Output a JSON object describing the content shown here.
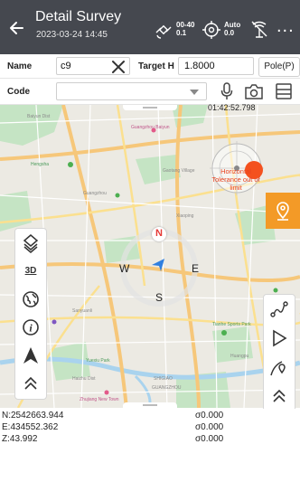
{
  "header": {
    "title": "Detail Survey",
    "subtitle": "2023-03-24 14:45",
    "sat_status": {
      "line1": "00-40",
      "line2": "0.1"
    },
    "fix_status": {
      "line1": "Auto",
      "line2": "0.0"
    },
    "more_label": "..."
  },
  "form": {
    "name_label": "Name",
    "name_value": "c9",
    "target_h_label": "Target H",
    "target_h_value": "1.8000",
    "pole_button": "Pole(P)",
    "code_label": "Code",
    "code_value": ""
  },
  "map": {
    "time": "01:42:52.798",
    "warning": "Horizontal Tolerance out of limit",
    "compass": {
      "n": "N",
      "s": "S",
      "w": "W",
      "e": "E"
    },
    "labels": [
      "Baiyun Dist",
      "Guangzhou Baiyun",
      "Hengsha",
      "Guangzhou",
      "Gaotang Village",
      "Xiaoping",
      "Sanyuanli",
      "Yuexiu Park",
      "Huangpu",
      "Haizhu Dist",
      "Zhujiang New Town",
      "Tianhe Sports Park",
      "SHIGIAO",
      "GUANGZHOU"
    ]
  },
  "toolbar_left": {
    "layers": "layers",
    "view3d": "3D",
    "globe": "globe",
    "info": "i",
    "north": "north",
    "collapse": "collapse"
  },
  "toolbar_right": {
    "route": "route",
    "stakeout": "stakeout",
    "line": "line",
    "collapse": "collapse"
  },
  "coords": {
    "n": "N:2542663.944",
    "e": "E:434552.362",
    "z": "Z:43.992",
    "sn": "σ0.000",
    "se": "σ0.000",
    "sz": "σ0.000"
  },
  "colors": {
    "header": "#45484f",
    "accent": "#f39a27",
    "warning": "#e8421e",
    "compass_n": "#e53935"
  }
}
